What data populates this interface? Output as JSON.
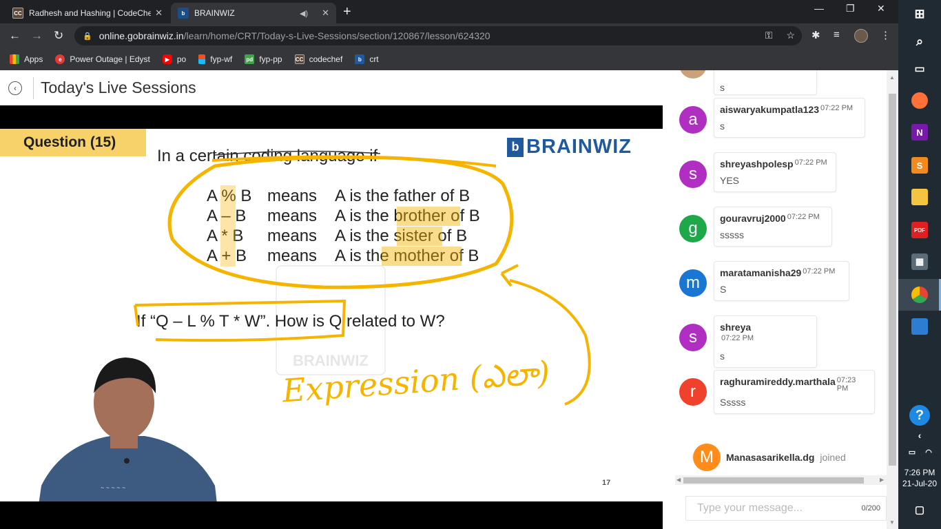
{
  "browser": {
    "tabs": [
      {
        "title": "Radhesh and Hashing | CodeChef",
        "icon": "CC",
        "active": false
      },
      {
        "title": "BRAINWIZ",
        "icon": "b",
        "active": true
      }
    ],
    "url": {
      "host": "online.gobrainwiz.in",
      "path": "/learn/home/CRT/Today-s-Live-Sessions/section/120867/lesson/624320"
    },
    "bookmarks": [
      {
        "label": "Apps",
        "icon": "apps-grid-icon"
      },
      {
        "label": "Power Outage | Edyst",
        "icon": "edyst-icon"
      },
      {
        "label": "po",
        "icon": "youtube-icon"
      },
      {
        "label": "fyp-wf",
        "icon": "figma-icon"
      },
      {
        "label": "fyp-pp",
        "icon": "pd-icon"
      },
      {
        "label": "codechef",
        "icon": "codechef-icon"
      },
      {
        "label": "crt",
        "icon": "brainwiz-icon"
      }
    ]
  },
  "page": {
    "title": "Today's Live Sessions"
  },
  "slide": {
    "question_label": "Question (15)",
    "intro": "In a certain coding language if",
    "logo_text": "BRAINWIZ",
    "rules": [
      {
        "expr": "A % B",
        "means": "means",
        "meaning": "A is the father of B"
      },
      {
        "expr": "A – B",
        "means": "means",
        "meaning": "A is the brother of B"
      },
      {
        "expr": "A * B",
        "means": "means",
        "meaning": "A is the sister of B"
      },
      {
        "expr": "A + B",
        "means": "means",
        "meaning": "A is the mother of B"
      }
    ],
    "question": "If “Q  –  L  %  T   *  W”.  How is Q related to W?",
    "watermark": "BRAINWIZ",
    "handwriting": "Expression (ఎలా)",
    "slide_number": "17"
  },
  "chat": {
    "messages": [
      {
        "initial": "",
        "color": "#c9a27a",
        "username": "",
        "time": "",
        "text": "s"
      },
      {
        "initial": "a",
        "color": "#b02fc2",
        "username": "aiswaryakumpatla123",
        "time": "07:22 PM",
        "text": "s"
      },
      {
        "initial": "s",
        "color": "#b02fc2",
        "username": "shreyashpolesp",
        "time": "07:22 PM",
        "text": "YES"
      },
      {
        "initial": "g",
        "color": "#1ea84a",
        "username": "gouravruj2000",
        "time": "07:22 PM",
        "text": "sssss"
      },
      {
        "initial": "m",
        "color": "#1976d2",
        "username": "maratamanisha29",
        "time": "07:22 PM",
        "text": "S"
      },
      {
        "initial": "s",
        "color": "#b02fc2",
        "username": "shreya",
        "time": "07:22 PM",
        "text": "s"
      },
      {
        "initial": "r",
        "color": "#f0412d",
        "username": "raghuramireddy.marthala",
        "time": "07:23 PM",
        "text": "Sssss"
      }
    ],
    "joined": {
      "initial": "M",
      "username": "Manasasarikella.dg",
      "status": "joined"
    },
    "input_placeholder": "Type your message...",
    "char_count": "0/200"
  },
  "taskbar": {
    "time": "7:26 PM",
    "date": "21-Jul-20"
  }
}
